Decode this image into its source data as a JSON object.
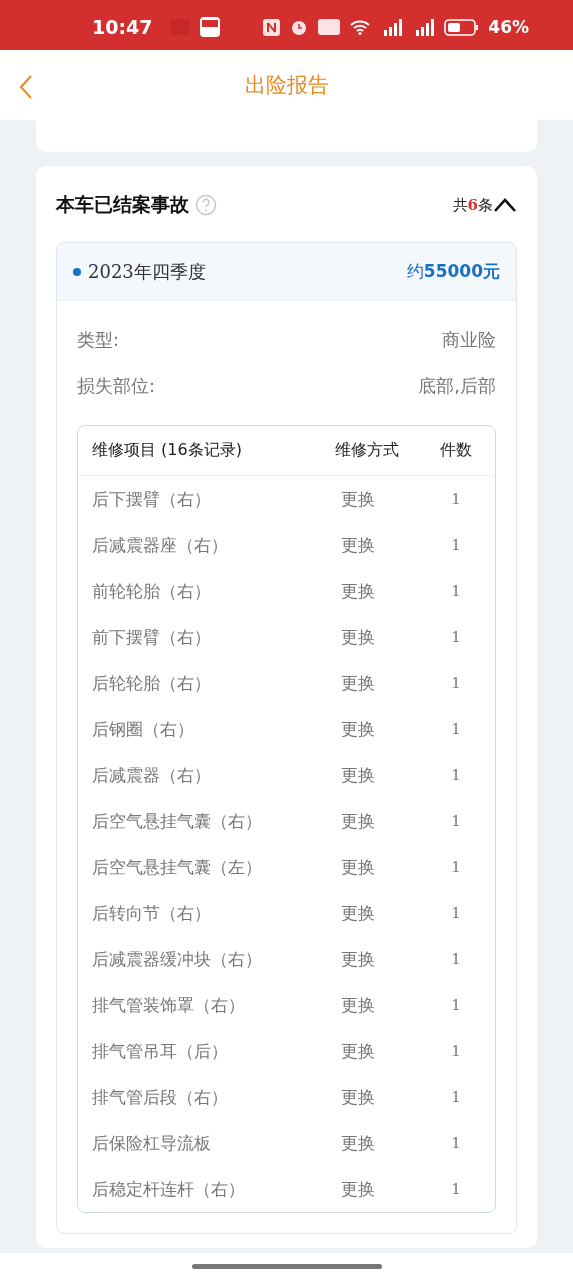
{
  "status_bar": {
    "time": "10:47",
    "battery": "46%"
  },
  "header": {
    "title": "出险报告"
  },
  "section": {
    "title": "本车已结案事故",
    "count": {
      "prefix": "共",
      "value": "6",
      "suffix": "条"
    },
    "expanded": true,
    "accident": {
      "period": "2023年四季度",
      "amount": "约**55000元**",
      "fields": [
        {
          "label": "类型:",
          "value": "商业险"
        },
        {
          "label": "损失部位:",
          "value": "底部,后部"
        }
      ],
      "table": {
        "columns": [
          "维修项目 (16条记录)",
          "维修方式",
          "件数"
        ],
        "rows": [
          [
            "后下摆臂（右）",
            "更换",
            "1"
          ],
          [
            "后减震器座（右）",
            "更换",
            "1"
          ],
          [
            "前轮轮胎（右）",
            "更换",
            "1"
          ],
          [
            "前下摆臂（右）",
            "更换",
            "1"
          ],
          [
            "后轮轮胎（右）",
            "更换",
            "1"
          ],
          [
            "后钢圈（右）",
            "更换",
            "1"
          ],
          [
            "后减震器（右）",
            "更换",
            "1"
          ],
          [
            "后空气悬挂气囊（右）",
            "更换",
            "1"
          ],
          [
            "后空气悬挂气囊（左）",
            "更换",
            "1"
          ],
          [
            "后转向节（右）",
            "更换",
            "1"
          ],
          [
            "后减震器缓冲块（右）",
            "更换",
            "1"
          ],
          [
            "排气管装饰罩（右）",
            "更换",
            "1"
          ],
          [
            "排气管吊耳（后）",
            "更换",
            "1"
          ],
          [
            "排气管后段（右）",
            "更换",
            "1"
          ],
          [
            "后保险杠导流板",
            "更换",
            "1"
          ],
          [
            "后稳定杆连杆（右）",
            "更换",
            "1"
          ]
        ]
      }
    }
  }
}
